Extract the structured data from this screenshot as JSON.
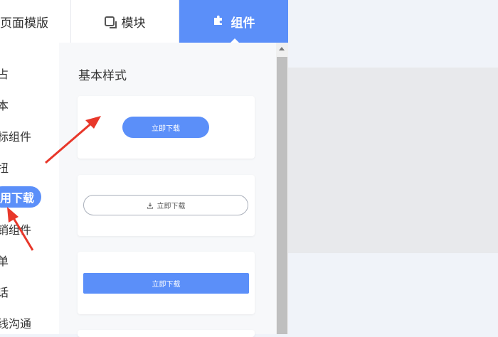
{
  "tabs": {
    "templates": "页面模版",
    "modules": "模块",
    "components": "组件"
  },
  "sidebar": {
    "items": [
      {
        "label": "占",
        "active": false
      },
      {
        "label": "本",
        "active": false
      },
      {
        "label": "标组件",
        "active": false
      },
      {
        "label": "扭",
        "active": false
      },
      {
        "label": "用下载",
        "active": true
      },
      {
        "label": "销组件",
        "active": false
      },
      {
        "label": "单",
        "active": false
      },
      {
        "label": "话",
        "active": false
      },
      {
        "label": "线沟通",
        "active": false
      }
    ]
  },
  "panel": {
    "section_title": "基本样式",
    "cards": [
      {
        "button_label": "立即下载",
        "style": "pill"
      },
      {
        "button_label": "立即下载",
        "style": "outline-with-download-icon"
      },
      {
        "button_label": "立即下载",
        "style": "rectangle"
      }
    ]
  },
  "colors": {
    "accent": "#5b8ff9",
    "arrow": "#e8372a"
  },
  "icons": {
    "modules_tab": "module-square-icon",
    "components_tab": "puzzle-piece-icon",
    "outline_button": "download-icon"
  }
}
